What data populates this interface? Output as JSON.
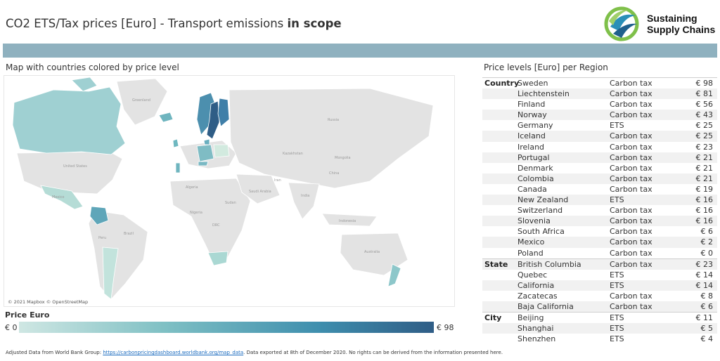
{
  "header": {
    "title_plain": "CO2 ETS/Tax prices [Euro] - Transport emissions ",
    "title_bold": "in scope",
    "logo_line1": "Sustaining",
    "logo_line2": "Supply Chains"
  },
  "map": {
    "label": "Map with countries colored by price level",
    "credit": "© 2021 Mapbox © OpenStreetMap",
    "place_labels": [
      "Greenland",
      "United States",
      "Mexico",
      "Brazil",
      "Peru",
      "Algeria",
      "Nigeria",
      "Sudan",
      "DRC",
      "Saudi Arabia",
      "Iran",
      "India",
      "Kazakhstan",
      "Russia",
      "Mongolia",
      "China",
      "Indonesia",
      "Australia"
    ]
  },
  "legend": {
    "title": "Price Euro",
    "min": "€ 0",
    "max": "€ 98",
    "color_low": "#cfe7e3",
    "color_high": "#2f5d86"
  },
  "table": {
    "title": "Price levels [Euro] per Region",
    "groups": [
      {
        "group": "Country",
        "rows": [
          {
            "region": "Sweden",
            "type": "Carbon tax",
            "price": "€ 98"
          },
          {
            "region": "Liechtenstein",
            "type": "Carbon tax",
            "price": "€ 81"
          },
          {
            "region": "Finland",
            "type": "Carbon tax",
            "price": "€ 56"
          },
          {
            "region": "Norway",
            "type": "Carbon tax",
            "price": "€ 43"
          },
          {
            "region": "Germany",
            "type": "ETS",
            "price": "€ 25"
          },
          {
            "region": "Iceland",
            "type": "Carbon tax",
            "price": "€ 25"
          },
          {
            "region": "Ireland",
            "type": "Carbon tax",
            "price": "€ 23"
          },
          {
            "region": "Portugal",
            "type": "Carbon tax",
            "price": "€ 21"
          },
          {
            "region": "Denmark",
            "type": "Carbon tax",
            "price": "€ 21"
          },
          {
            "region": "Colombia",
            "type": "Carbon tax",
            "price": "€ 21"
          },
          {
            "region": "Canada",
            "type": "Carbon tax",
            "price": "€ 19"
          },
          {
            "region": "New Zealand",
            "type": "ETS",
            "price": "€ 16"
          },
          {
            "region": "Switzerland",
            "type": "Carbon tax",
            "price": "€ 16"
          },
          {
            "region": "Slovenia",
            "type": "Carbon tax",
            "price": "€ 16"
          },
          {
            "region": "South Africa",
            "type": "Carbon tax",
            "price": "€ 6"
          },
          {
            "region": "Mexico",
            "type": "Carbon tax",
            "price": "€ 2"
          },
          {
            "region": "Poland",
            "type": "Carbon tax",
            "price": "€ 0"
          }
        ]
      },
      {
        "group": "State",
        "rows": [
          {
            "region": "British Columbia",
            "type": "Carbon tax",
            "price": "€ 23"
          },
          {
            "region": "Quebec",
            "type": "ETS",
            "price": "€ 14"
          },
          {
            "region": "California",
            "type": "ETS",
            "price": "€ 14"
          },
          {
            "region": "Zacatecas",
            "type": "Carbon tax",
            "price": "€ 8"
          },
          {
            "region": "Baja California",
            "type": "Carbon tax",
            "price": "€ 6"
          }
        ]
      },
      {
        "group": "City",
        "rows": [
          {
            "region": "Beijing",
            "type": "ETS",
            "price": "€ 11"
          },
          {
            "region": "Shanghai",
            "type": "ETS",
            "price": "€ 5"
          },
          {
            "region": "Shenzhen",
            "type": "ETS",
            "price": "€ 4"
          }
        ]
      }
    ]
  },
  "footer": {
    "prefix": "Adjusted Data from World Bank Group: ",
    "link": "https://carbonpricingdashboard.worldbank.org/map_data",
    "suffix": ". Data exported at 8th of December 2020. No rights can be derived from the information presented here."
  }
}
